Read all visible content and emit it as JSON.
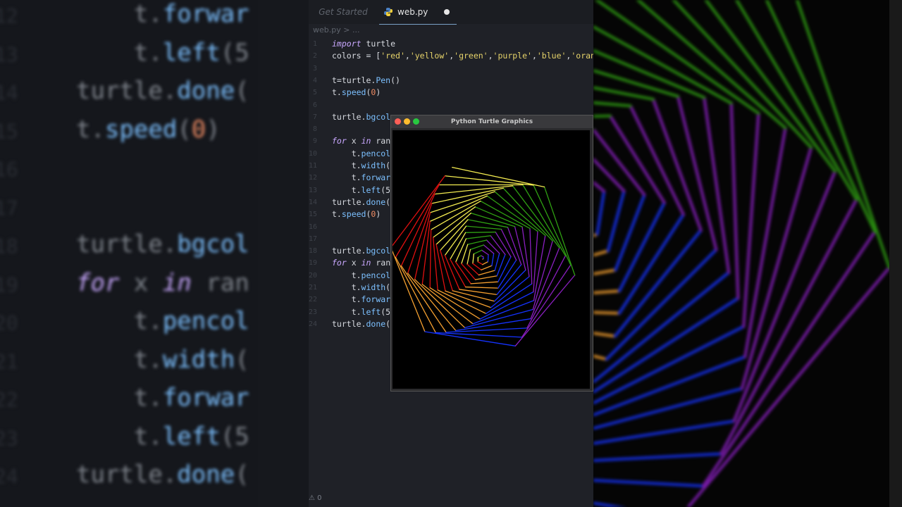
{
  "editor": {
    "tabs": [
      {
        "label": "Get Started",
        "active": false
      },
      {
        "label": "web.py",
        "active": true,
        "modified": true
      }
    ],
    "breadcrumb": "web.py > ...",
    "lines": [
      {
        "n": "1",
        "code": "import turtle"
      },
      {
        "n": "2",
        "code": "colors = ['red','yellow','green','purple','blue','oran"
      },
      {
        "n": "3",
        "code": ""
      },
      {
        "n": "4",
        "code": "t=turtle.Pen()"
      },
      {
        "n": "5",
        "code": "t.speed(0)"
      },
      {
        "n": "6",
        "code": ""
      },
      {
        "n": "7",
        "code": "turtle.bgcol"
      },
      {
        "n": "8",
        "code": ""
      },
      {
        "n": "9",
        "code": "for x in ran"
      },
      {
        "n": "10",
        "code": "    t.pencol"
      },
      {
        "n": "11",
        "code": "    t.width("
      },
      {
        "n": "12",
        "code": "    t.forwar"
      },
      {
        "n": "13",
        "code": "    t.left(5"
      },
      {
        "n": "14",
        "code": "turtle.done("
      },
      {
        "n": "15",
        "code": "t.speed(0)"
      },
      {
        "n": "16",
        "code": ""
      },
      {
        "n": "17",
        "code": ""
      },
      {
        "n": "18",
        "code": "turtle.bgcol"
      },
      {
        "n": "19",
        "code": "for x in ran"
      },
      {
        "n": "20",
        "code": "    t.pencol"
      },
      {
        "n": "21",
        "code": "    t.width("
      },
      {
        "n": "22",
        "code": "    t.forwar"
      },
      {
        "n": "23",
        "code": "    t.left(5"
      },
      {
        "n": "24",
        "code": "turtle.done("
      }
    ],
    "status_count": "0"
  },
  "turtle_window": {
    "title": "Python Turtle Graphics",
    "colors": [
      "#e01010",
      "#f5a030",
      "#1533ff",
      "#8a1fc0",
      "#2fa012",
      "#f4ec50"
    ]
  },
  "background_left": {
    "lines": [
      {
        "n": "12",
        "code": "    t.forwar"
      },
      {
        "n": "13",
        "code": "    t.left(5"
      },
      {
        "n": "14",
        "code": "turtle.done("
      },
      {
        "n": "15",
        "code": "t.speed(0)"
      },
      {
        "n": "16",
        "code": ""
      },
      {
        "n": "17",
        "code": ""
      },
      {
        "n": "18",
        "code": "turtle.bgcol"
      },
      {
        "n": "19",
        "code": "for x in ran"
      },
      {
        "n": "20",
        "code": "    t.pencol"
      },
      {
        "n": "21",
        "code": "    t.width("
      },
      {
        "n": "22",
        "code": "    t.forwar"
      },
      {
        "n": "23",
        "code": "    t.left(5"
      },
      {
        "n": "24",
        "code": "turtle.done("
      }
    ]
  }
}
